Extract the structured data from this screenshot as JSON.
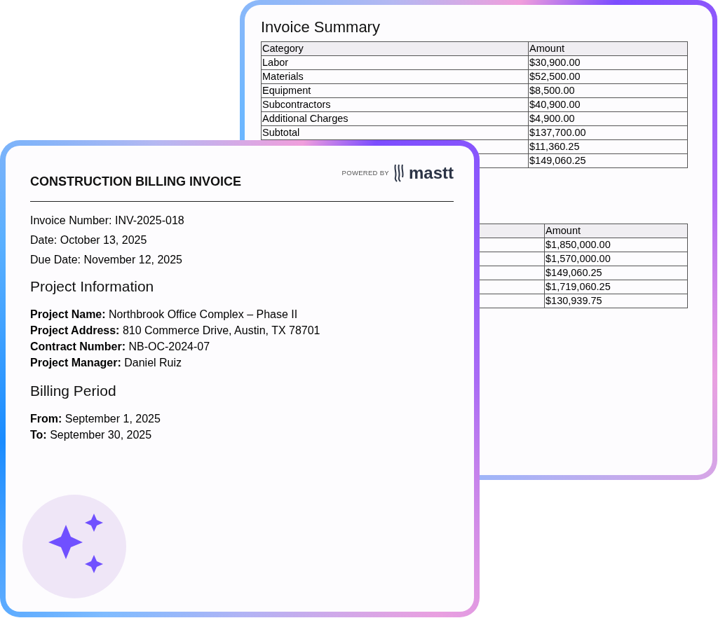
{
  "summary_page": {
    "title": "Invoice Summary",
    "table": {
      "columns": [
        "Category",
        "Amount"
      ],
      "rows": [
        {
          "category": "Labor",
          "amount": "$30,900.00"
        },
        {
          "category": "Materials",
          "amount": "$52,500.00"
        },
        {
          "category": "Equipment",
          "amount": "$8,500.00"
        },
        {
          "category": "Subcontractors",
          "amount": "$40,900.00"
        },
        {
          "category": "Additional Charges",
          "amount": "$4,900.00"
        },
        {
          "category": "Subtotal",
          "amount": "$137,700.00"
        },
        {
          "amount": "$11,360.25"
        },
        {
          "amount": "$149,060.25"
        }
      ]
    },
    "table_2": {
      "column_2": "Amount",
      "rows": [
        {
          "amount": "$1,850,000.00"
        },
        {
          "amount": "$1,570,000.00"
        },
        {
          "amount": "$149,060.25"
        },
        {
          "amount": "$1,719,060.25"
        },
        {
          "amount": "$130,939.75"
        }
      ]
    }
  },
  "invoice_page": {
    "title": "CONSTRUCTION BILLING INVOICE",
    "powered_by": "POWERED BY",
    "brand": "mastt",
    "lines": [
      "Invoice Number: INV-2025-018",
      "Date: October 13, 2025",
      "Due Date: November 12, 2025"
    ],
    "sections": [
      {
        "heading": "Project Information",
        "fields": [
          "**Project Name:** Northbrook Office Complex – Phase II",
          "**Project Address:** 810 Commerce Drive, Austin, TX 78701",
          "**Contract Number:** NB-OC-2024-07",
          "**Project Manager:** Daniel Ruiz"
        ]
      },
      {
        "heading": "Billing Period",
        "fields": [
          "**From:** September 1, 2025",
          "**To:** September 30, 2025"
        ]
      }
    ]
  }
}
